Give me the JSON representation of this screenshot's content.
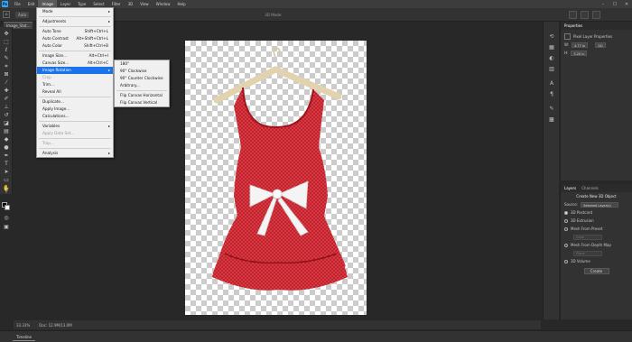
{
  "menubar": {
    "app_icon": "Ps",
    "items": [
      "File",
      "Edit",
      "Image",
      "Layer",
      "Type",
      "Select",
      "Filter",
      "3D",
      "View",
      "Window",
      "Help"
    ],
    "active": "Image",
    "window_controls": {
      "minimize": "–",
      "maximize": "☐",
      "close": "✕"
    }
  },
  "options": {
    "home": "⌂",
    "field1": "Auto",
    "mode_3d": "3D Mode:"
  },
  "document": {
    "tab_title": "Image_Stat..."
  },
  "image_menu": {
    "items": [
      {
        "label": "Mode",
        "submenu": true
      },
      {
        "sep": true
      },
      {
        "label": "Adjustments",
        "submenu": true
      },
      {
        "sep": true
      },
      {
        "label": "Auto Tone",
        "shortcut": "Shift+Ctrl+L"
      },
      {
        "label": "Auto Contrast",
        "shortcut": "Alt+Shift+Ctrl+L"
      },
      {
        "label": "Auto Color",
        "shortcut": "Shift+Ctrl+B"
      },
      {
        "sep": true
      },
      {
        "label": "Image Size...",
        "shortcut": "Alt+Ctrl+I"
      },
      {
        "label": "Canvas Size...",
        "shortcut": "Alt+Ctrl+C"
      },
      {
        "label": "Image Rotation",
        "submenu": true,
        "highlighted": true
      },
      {
        "label": "Crop",
        "disabled": true
      },
      {
        "label": "Trim..."
      },
      {
        "label": "Reveal All"
      },
      {
        "sep": true
      },
      {
        "label": "Duplicate..."
      },
      {
        "label": "Apply Image..."
      },
      {
        "label": "Calculations..."
      },
      {
        "sep": true
      },
      {
        "label": "Variables",
        "submenu": true
      },
      {
        "label": "Apply Data Set...",
        "disabled": true
      },
      {
        "sep": true
      },
      {
        "label": "Trap...",
        "disabled": true
      },
      {
        "sep": true
      },
      {
        "label": "Analysis",
        "submenu": true
      }
    ]
  },
  "rotation_submenu": {
    "items": [
      {
        "label": "180°"
      },
      {
        "label": "90° Clockwise"
      },
      {
        "label": "90° Counter Clockwise"
      },
      {
        "label": "Arbitrary..."
      },
      {
        "sep": true
      },
      {
        "label": "Flip Canvas Horizontal"
      },
      {
        "label": "Flip Canvas Vertical"
      }
    ]
  },
  "status": {
    "zoom": "33.33%",
    "doc_info": "Doc: 12.9M/13.0M"
  },
  "timeline": {
    "label": "Timeline"
  },
  "properties": {
    "tab": "Properties",
    "subtitle": "Pixel Layer Properties",
    "w_label": "W:",
    "w_value": "4.77 in",
    "go_label": "GO",
    "h_label": "H:",
    "h_value": "3.20 in"
  },
  "layers_panel": {
    "tabs": [
      "Layers",
      "Channels"
    ],
    "title": "Create New 3D Object",
    "source_label": "Source:",
    "source_value": "Selected Layer(s)",
    "options": [
      {
        "label": "3D Postcard",
        "checked": true
      },
      {
        "label": "3D Extrusion",
        "checked": false
      },
      {
        "label": "Mesh From Preset",
        "checked": false
      },
      {
        "label": "Cone",
        "field": true
      },
      {
        "label": "Mesh From Depth Map",
        "checked": false
      },
      {
        "label": "Plane",
        "field": true
      },
      {
        "label": "3D Volume",
        "checked": false
      }
    ],
    "create_label": "Create"
  },
  "colors": {
    "accent": "#1a73e8",
    "dress_red": "#c8202a",
    "bow_white": "#f4f4f4"
  }
}
